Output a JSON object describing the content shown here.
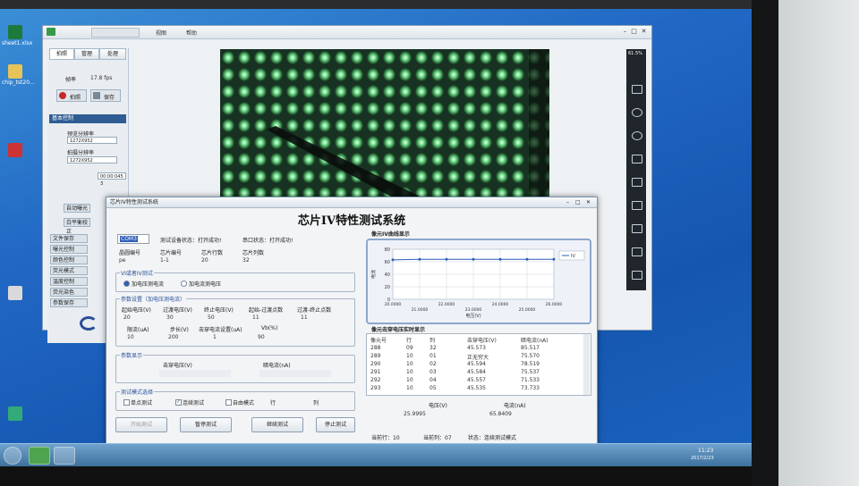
{
  "desktop": {
    "icons": [
      {
        "label": "sheet1.xlsx"
      },
      {
        "label": "chip_tst20..."
      }
    ],
    "clock": {
      "time": "11:23",
      "date": "2017/2/23"
    }
  },
  "main_window": {
    "menu": [
      "视图",
      "帮助"
    ],
    "tabs": [
      "拍照",
      "管理",
      "处理"
    ],
    "fps_label": "帧率",
    "fps_value": "17.8 fps",
    "btn_record": "拍照",
    "btn_save": "保存",
    "section_basic": "基本控制",
    "preview_label": "预览分辨率",
    "preview_value": "1272X952",
    "capture_label": "拍摄分辨率",
    "capture_value": "1272X952",
    "small_value": "00:00:045 3",
    "auto_exposure": "自动曝光",
    "auto_wb": "白平衡校正",
    "side_items": [
      "文件保存",
      "曝光控制",
      "颜色控制",
      "荧光模式",
      "温度控制",
      "荧光染色",
      "参数保存"
    ],
    "zoom": "61.5%"
  },
  "dialog": {
    "title": "芯片IV特性测试系统",
    "heading": "芯片IV特性测试系统",
    "device_value": "COM3",
    "device_status": "测试设备状态：打开成功!",
    "port_status": "串口状态：打开成功!",
    "info_labels": [
      "晶圆编号",
      "芯片编号",
      "芯片行数",
      "芯片列数"
    ],
    "info_values": [
      "pe",
      "1-1",
      "20",
      "32"
    ],
    "vi_group": "VI或者IV测试",
    "vi_option1": "加电压测电流",
    "vi_option2": "加电流测电压",
    "param_group": "参数设置（加电压测电流）",
    "param_labels1": [
      "起始电压(V)",
      "过渡电压(V)",
      "终止电压(V)",
      "起始-过渡点数",
      "过渡-终止点数"
    ],
    "param_values1": [
      "20",
      "30",
      "50",
      "11",
      "11"
    ],
    "param_labels2": [
      "限流(uA)",
      "步长(V)",
      "击穿电流设置(uA)",
      "Vb(%)"
    ],
    "param_values2": [
      "10",
      "200",
      "1",
      "90"
    ],
    "display_group": "参数显示",
    "display_labels": [
      "击穿电压(V)",
      "暗电流(nA)"
    ],
    "mode_group": "测试模式选择",
    "mode_options": [
      "单点测试",
      "连续测试",
      "自由模式"
    ],
    "mode_row": "行",
    "mode_col": "列",
    "buttons": [
      "开始测试",
      "暂停测试",
      "继续测试",
      "停止测试"
    ],
    "chart_title": "像元IV曲线显示",
    "table_title": "像元击穿电压实时显示",
    "table_headers": [
      "像元号",
      "行",
      "列",
      "击穿电压(V)",
      "暗电流(nA)"
    ],
    "table_rows": [
      [
        "288",
        "09",
        "32",
        "45.573",
        "85.517"
      ],
      [
        "289",
        "10",
        "01",
        "正无穷大",
        "75.570"
      ],
      [
        "290",
        "10",
        "02",
        "45.594",
        "78.519"
      ],
      [
        "291",
        "10",
        "03",
        "45.584",
        "75.537"
      ],
      [
        "292",
        "10",
        "04",
        "45.557",
        "71.533"
      ],
      [
        "293",
        "10",
        "05",
        "45.535",
        "73.733"
      ]
    ],
    "bottom_labels": [
      "电压(V)",
      "电流(nA)"
    ],
    "bottom_values": [
      "25.9995",
      "65.8409"
    ],
    "status_row": "当前行：10",
    "status_col": "当前列：07",
    "status_state": "状态：连续测试模式"
  },
  "chart_data": {
    "type": "line",
    "title": "",
    "xlabel": "电压(V)",
    "ylabel": "电流",
    "x_ticks": [
      "20.0000",
      "21.0000",
      "22.0000",
      "23.0000",
      "24.0000",
      "25.0000",
      "26.0000"
    ],
    "y_ticks": [
      "0",
      "20",
      "40",
      "60",
      "80"
    ],
    "ylim": [
      0,
      80
    ],
    "xlim": [
      20,
      26
    ],
    "grid": true,
    "legend": "top-right",
    "series": [
      {
        "name": "IV",
        "color": "#2f5db8",
        "x": [
          20,
          21,
          22,
          23,
          24,
          25,
          26
        ],
        "y": [
          63,
          64,
          64,
          64,
          64,
          64,
          64
        ]
      }
    ]
  }
}
